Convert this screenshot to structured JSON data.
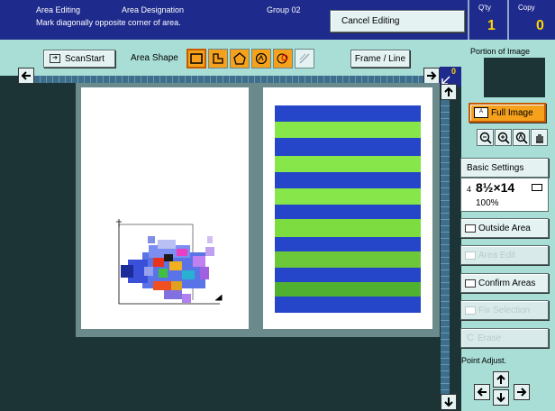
{
  "header": {
    "mode_title": "Area Editing",
    "sub_title": "Area Designation",
    "group_label": "Group 02",
    "instruction": "Mark diagonally opposite corner of area.",
    "cancel_label": "Cancel Editing",
    "qty_label": "Q'ty",
    "qty_value": "1",
    "copy_label": "Copy",
    "copy_value": "0"
  },
  "toolbar": {
    "scan_start_label": "ScanStart",
    "area_shape_label": "Area Shape",
    "frame_line_label": "Frame / Line"
  },
  "right_panel": {
    "portion_label": "Portion of Image",
    "full_image_label": "Full Image",
    "basic_settings_label": "Basic Settings",
    "paper_tray": "4",
    "paper_size": "8½×14",
    "zoom_value": "100%",
    "outside_area_label": "Outside Area",
    "area_edit_label": "Area Edit",
    "confirm_areas_label": "Confirm Areas",
    "fix_selection_label": "Fix Selection",
    "erase_label": "Erase",
    "point_adjust_label": "Point Adjust."
  },
  "ruler_corner_value": "0",
  "colors": {
    "header_bg": "#1e2a8c",
    "panel_bg": "#a9ded7",
    "active_orange": "#f6a11c",
    "count_yellow": "#ffd200",
    "stripe_blue": "#2546c8",
    "stripe_green": "#86e64a"
  }
}
